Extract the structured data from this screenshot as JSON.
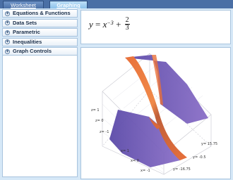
{
  "tabs": {
    "worksheet": "Worksheet",
    "graphing": "Graphing"
  },
  "sidebar": {
    "items": [
      {
        "label": "Equations & Functions"
      },
      {
        "label": "Data Sets"
      },
      {
        "label": "Parametric"
      },
      {
        "label": "Inequalities"
      },
      {
        "label": "Graph Controls"
      }
    ],
    "expand_symbol": "+"
  },
  "formula": {
    "lhs": "y",
    "eq": " = ",
    "base": "x",
    "exp": "−3",
    "plus": " + ",
    "num": "2",
    "den": "3"
  },
  "graph": {
    "surface_colors": {
      "purple": "#6b55b5",
      "orange": "#e8703a"
    },
    "axis_labels": {
      "z1": "z= 1",
      "z0": "z= 0",
      "zm1": "z= -1",
      "x1": "x= 1",
      "x0": "x= 0",
      "xm1": "x= -1",
      "y1": "y= 15.75",
      "y0": "y= -0.5",
      "ym1": "y= -16.75"
    }
  }
}
